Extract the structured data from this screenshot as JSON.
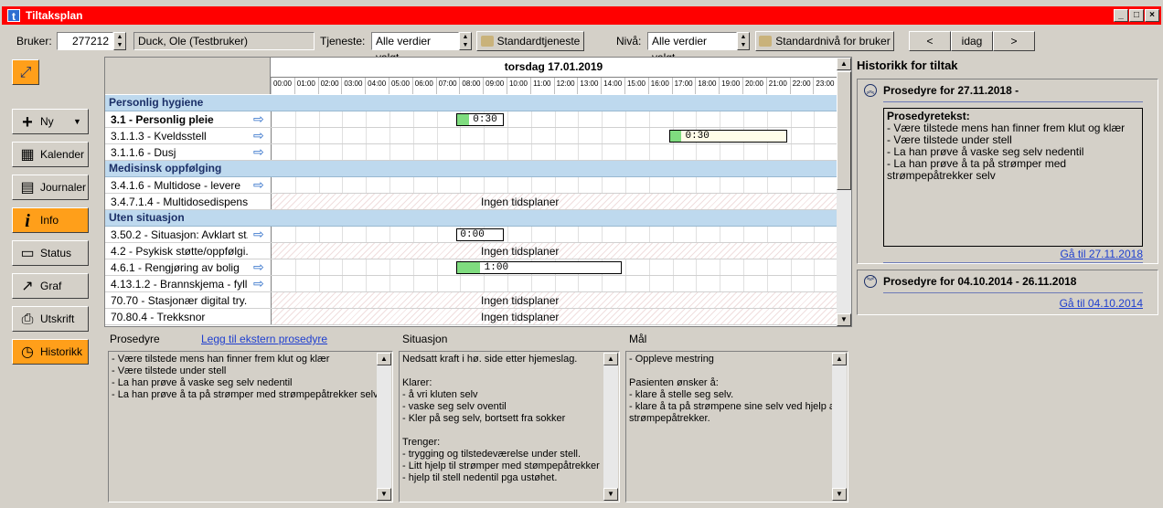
{
  "window": {
    "title": "Tiltaksplan",
    "app_icon": "t"
  },
  "toolbar": {
    "bruker_label": "Bruker:",
    "bruker_id": "277212",
    "bruker_name": "Duck, Ole (Testbruker)",
    "tjeneste_label": "Tjeneste:",
    "tjeneste_value": "Alle verdier valgt",
    "standardtjeneste_label": "Standardtjeneste",
    "niva_label": "Nivå:",
    "niva_value": "Alle verdier valgt",
    "standardniva_label": "Standardnivå for bruker",
    "prev_label": "<",
    "today_label": "idag",
    "next_label": ">"
  },
  "sidebar": {
    "items": [
      {
        "label": "Ny",
        "icon": "plus-icon"
      },
      {
        "label": "Kalender",
        "icon": "calendar-icon"
      },
      {
        "label": "Journaler",
        "icon": "journal-icon"
      },
      {
        "label": "Info",
        "icon": "info-icon"
      },
      {
        "label": "Status",
        "icon": "status-icon"
      },
      {
        "label": "Graf",
        "icon": "chart-icon"
      },
      {
        "label": "Utskrift",
        "icon": "printer-icon"
      },
      {
        "label": "Historikk",
        "icon": "clock-icon"
      }
    ]
  },
  "schedule": {
    "date": "torsdag 17.01.2019",
    "hours": [
      "00:00",
      "01:00",
      "02:00",
      "03:00",
      "04:00",
      "05:00",
      "06:00",
      "07:00",
      "08:00",
      "09:00",
      "10:00",
      "11:00",
      "12:00",
      "13:00",
      "14:00",
      "15:00",
      "16:00",
      "17:00",
      "18:00",
      "19:00",
      "20:00",
      "21:00",
      "22:00",
      "23:00"
    ],
    "no_plan_text": "Ingen tidsplaner",
    "rows": [
      {
        "type": "cat",
        "label": "Personlig hygiene"
      },
      {
        "type": "item",
        "label": "3.1 - Personlig pleie",
        "bold": true,
        "arrow": true,
        "bar": {
          "start": 8,
          "len": 2,
          "text": "0:30",
          "fill": 0.25
        }
      },
      {
        "type": "item",
        "label": "3.1.1.3 - Kveldsstell",
        "arrow": true,
        "bar": {
          "start": 17,
          "len": 5,
          "text": "0:30",
          "fill": 0.1,
          "yellow": true
        }
      },
      {
        "type": "item",
        "label": "3.1.1.6 - Dusj",
        "arrow": true
      },
      {
        "type": "cat",
        "label": "Medisinsk oppfølging"
      },
      {
        "type": "item",
        "label": "3.4.1.6 - Multidose - levere",
        "arrow": true
      },
      {
        "type": "item",
        "label": "3.4.7.1.4 - Multidosedispens...",
        "hatch": true
      },
      {
        "type": "cat",
        "label": "Uten situasjon"
      },
      {
        "type": "item",
        "label": "3.50.2 - Situasjon: Avklart st...",
        "arrow": true,
        "bar": {
          "start": 8,
          "len": 2,
          "text": "0:00",
          "fill": 0.0
        }
      },
      {
        "type": "item",
        "label": "4.2 - Psykisk støtte/oppfølgi...",
        "hatch": true
      },
      {
        "type": "item",
        "label": "4.6.1 - Rengjøring av bolig",
        "arrow": true,
        "bar": {
          "start": 8,
          "len": 7,
          "text": "1:00",
          "fill": 0.14
        }
      },
      {
        "type": "item",
        "label": "4.13.1.2 - Brannskjema - fyll...",
        "arrow": true
      },
      {
        "type": "item",
        "label": "70.70 - Stasjonær digital try...",
        "hatch": true
      },
      {
        "type": "item",
        "label": "70.80.4 - Trekksnor",
        "hatch": true
      }
    ]
  },
  "lower": {
    "prosedyre_title": "Prosedyre",
    "prosedyre_link": "Legg til ekstern prosedyre",
    "prosedyre_text": "- Være tilstede mens han finner frem klut og klær\n- Være tilstede under stell\n- La han prøve å vaske seg selv nedentil\n- La han prøve å ta på strømper med strømpepåtrekker selv",
    "situasjon_title": "Situasjon",
    "situasjon_text": "Nedsatt kraft i hø. side etter hjemeslag.\n\nKlarer:\n- å vri kluten selv\n- vaske seg selv oventil\n- Kler på seg selv, bortsett fra sokker\n\nTrenger:\n- trygging og tilstedeværelse under stell.\n- Litt hjelp til strømper med stømpepåtrekker\n- hjelp til stell nedentil pga ustøhet.",
    "mal_title": "Mål",
    "mal_text": "- Oppleve mestring\n\nPasienten ønsker å:\n- klare å stelle seg selv.\n- klare å ta på strømpene sine selv ved hjelp av strømpepåtrekker."
  },
  "history": {
    "title": "Historikk for tiltak",
    "entry1_title": "Prosedyre for 27.11.2018 -",
    "entry1_heading": "Prosedyretekst:",
    "entry1_text": "- Være tilstede mens han finner frem klut og klær\n- Være tilstede under stell\n- La han prøve å vaske seg selv nedentil\n- La han prøve å ta på strømper med strømpepåtrekker selv",
    "entry1_link": "Gå til 27.11.2018",
    "entry2_title": "Prosedyre for 04.10.2014 - 26.11.2018",
    "entry2_link": "Gå til 04.10.2014"
  },
  "colors": {
    "titlebar": "#ff0000",
    "category_bg": "#bed9ee",
    "accent_orange": "#ff9f1a",
    "bar_green": "#7fdc7f"
  }
}
